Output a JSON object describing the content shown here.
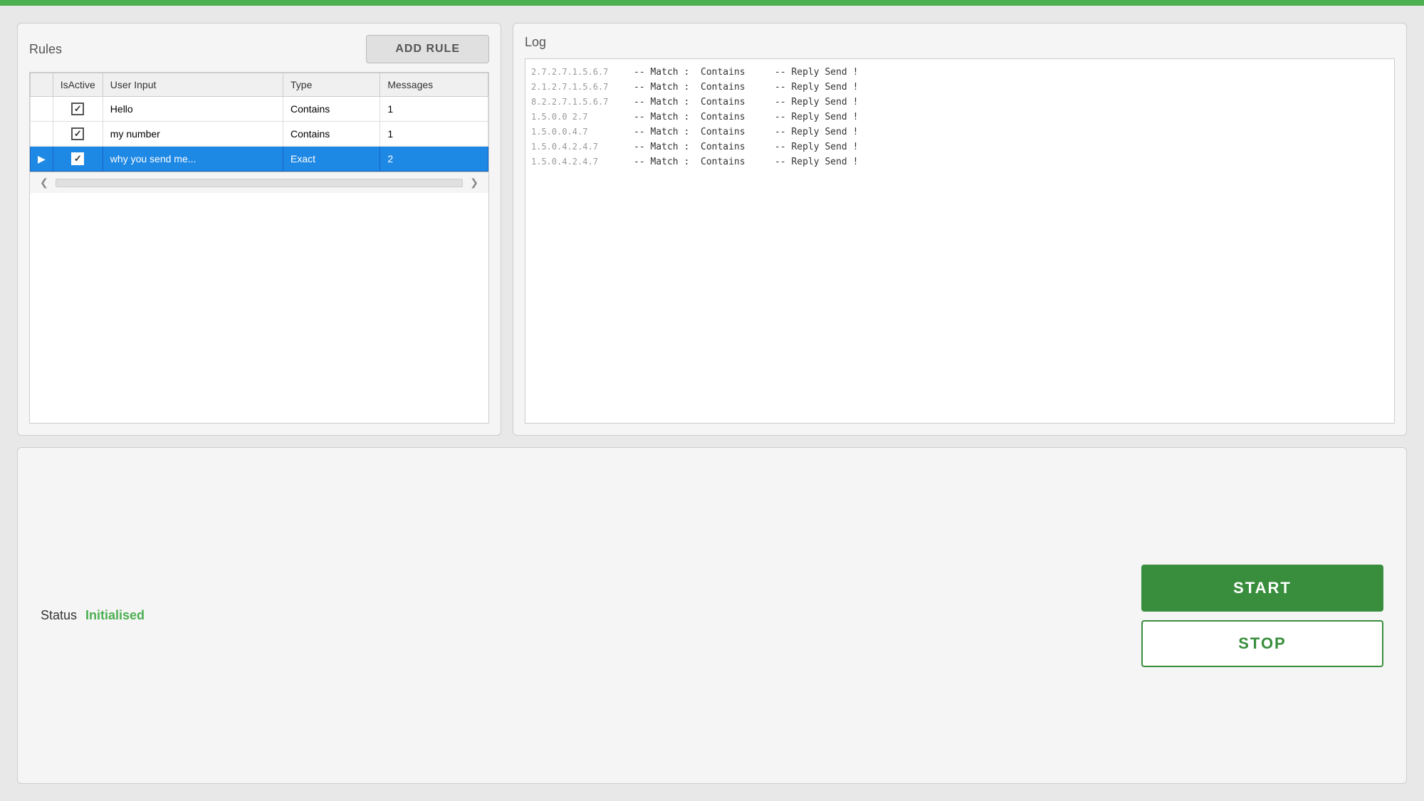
{
  "topbar": {},
  "rules_panel": {
    "title": "Rules",
    "add_rule_btn": "ADD RULE",
    "table": {
      "columns": [
        "IsActive",
        "User Input",
        "Type",
        "Messages"
      ],
      "rows": [
        {
          "id": 1,
          "isActive": true,
          "userInput": "Hello",
          "type": "Contains",
          "messages": "1",
          "selected": false,
          "hasArrow": false
        },
        {
          "id": 2,
          "isActive": true,
          "userInput": "my number",
          "type": "Contains",
          "messages": "1",
          "selected": false,
          "hasArrow": false
        },
        {
          "id": 3,
          "isActive": true,
          "userInput": "why you send me...",
          "type": "Exact",
          "messages": "2",
          "selected": true,
          "hasArrow": true
        }
      ]
    },
    "scroll_left": "❮",
    "scroll_right": "❯"
  },
  "log_panel": {
    "title": "Log",
    "entries": [
      {
        "timestamp": "2.7.2.7.1.5.6.7",
        "match": "-- Match :",
        "type": "Contains",
        "reply": "-- Reply Send !"
      },
      {
        "timestamp": "2.1.2.7.1.5.6.7",
        "match": "-- Match :",
        "type": "Contains",
        "reply": "-- Reply Send !"
      },
      {
        "timestamp": "8.2.2.7.1.5.6.7",
        "match": "-- Match :",
        "type": "Contains",
        "reply": "-- Reply Send !"
      },
      {
        "timestamp": "1.5.0.0 2.7",
        "match": "-- Match :",
        "type": "Contains",
        "reply": "-- Reply Send !"
      },
      {
        "timestamp": "1.5.0.0.4.7",
        "match": "-- Match :",
        "type": "Contains",
        "reply": "-- Reply Send !"
      },
      {
        "timestamp": "1.5.0.4.2.4.7",
        "match": "-- Match :",
        "type": "Contains",
        "reply": "-- Reply Send !"
      },
      {
        "timestamp": "1.5.0.4.2.4.7",
        "match": "-- Match :",
        "type": "Contains",
        "reply": "-- Reply Send !"
      }
    ]
  },
  "status_area": {
    "label": "Status",
    "value": "Initialised"
  },
  "buttons": {
    "start": "START",
    "stop": "STOP"
  }
}
